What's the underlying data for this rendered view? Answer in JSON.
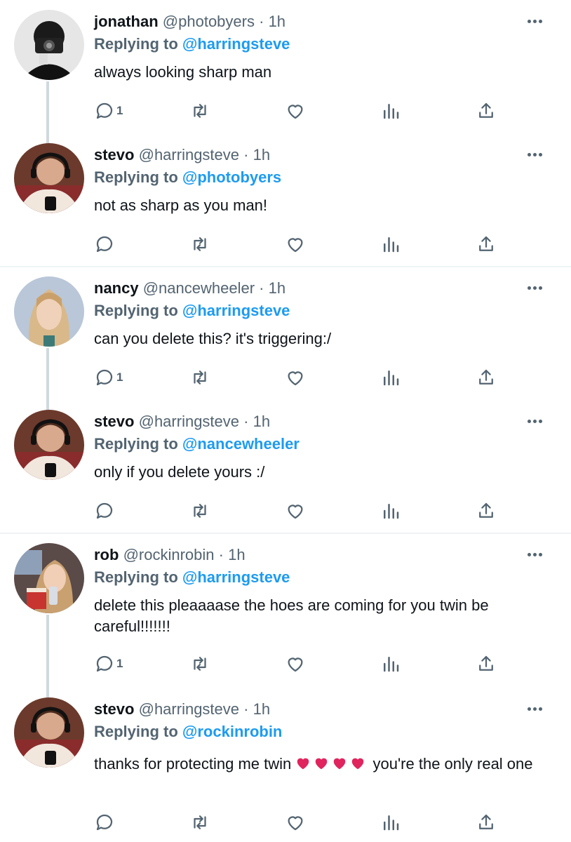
{
  "tweets": [
    {
      "name": "jonathan",
      "handle": "@photobyers",
      "separator": "·",
      "time": "1h",
      "replying_prefix": "Replying to",
      "replying_to": "@harringsteve",
      "text": "always looking sharp man",
      "reply_count": "1",
      "avatar_icon": "camera-person-avatar"
    },
    {
      "name": "stevo",
      "handle": "@harringsteve",
      "separator": "·",
      "time": "1h",
      "replying_prefix": "Replying to",
      "replying_to": "@photobyers",
      "text": "not as sharp as you man!",
      "reply_count": "",
      "avatar_icon": "person-headphones-avatar"
    },
    {
      "name": "nancy",
      "handle": "@nancewheeler",
      "separator": "·",
      "time": "1h",
      "replying_prefix": "Replying to",
      "replying_to": "@harringsteve",
      "text": "can you delete this? it's triggering:/",
      "reply_count": "1",
      "avatar_icon": "blonde-person-avatar"
    },
    {
      "name": "stevo",
      "handle": "@harringsteve",
      "separator": "·",
      "time": "1h",
      "replying_prefix": "Replying to",
      "replying_to": "@nancewheeler",
      "text": "only if you delete yours :/",
      "reply_count": "",
      "avatar_icon": "person-headphones-avatar"
    },
    {
      "name": "rob",
      "handle": "@rockinrobin",
      "separator": "·",
      "time": "1h",
      "replying_prefix": "Replying to",
      "replying_to": "@harringsteve",
      "text": "delete this pleaaaase the hoes are coming for you twin be careful!!!!!!!",
      "reply_count": "1",
      "avatar_icon": "person-drink-avatar"
    },
    {
      "name": "stevo",
      "handle": "@harringsteve",
      "separator": "·",
      "time": "1h",
      "replying_prefix": "Replying to",
      "replying_to": "@rockinrobin",
      "text_before": "thanks for protecting me twin",
      "hearts": 4,
      "text_after": "you're the only real one",
      "reply_count": "",
      "avatar_icon": "person-headphones-avatar"
    }
  ],
  "colors": {
    "link": "#1d9bf0",
    "secondary": "#536471",
    "thread_line": "#cfd9de",
    "heart": "#e0245e"
  }
}
